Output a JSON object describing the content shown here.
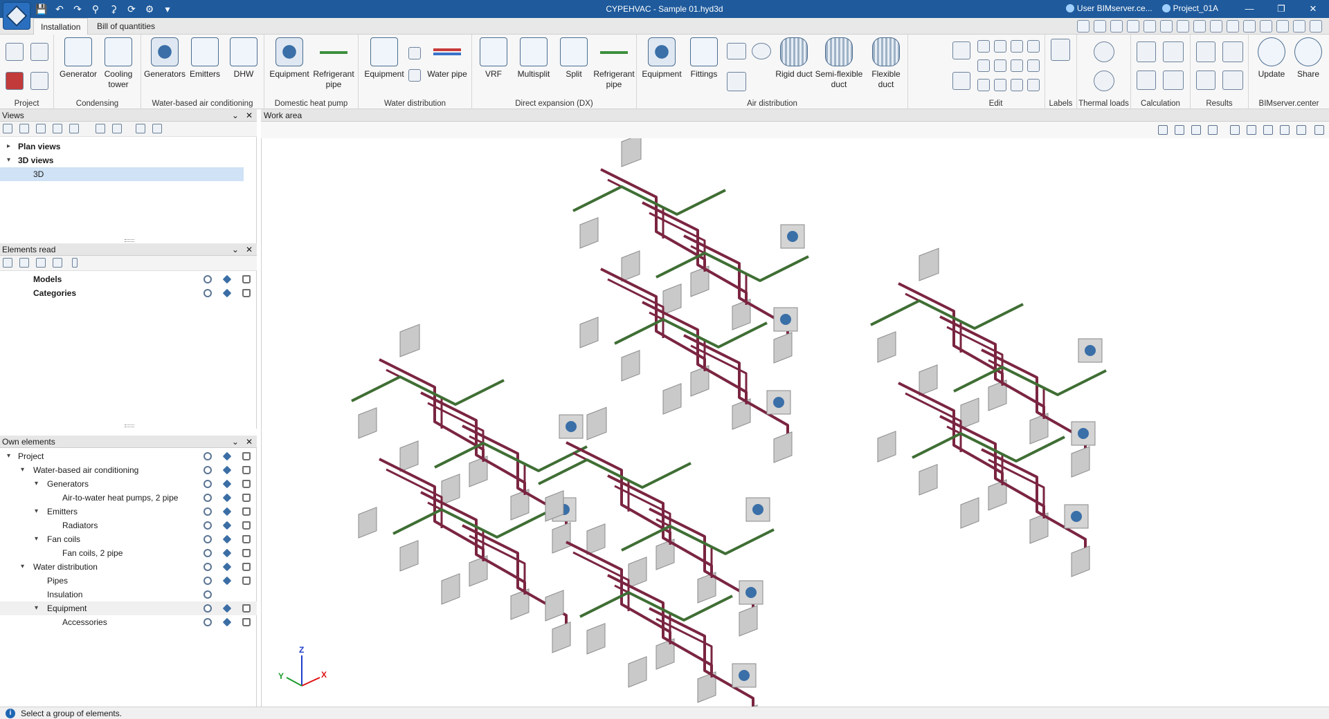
{
  "titlebar": {
    "title": "CYPEHVAC - Sample 01.hyd3d",
    "user": "User BIMserver.ce...",
    "project": "Project_01A",
    "qat_icons": [
      "save-icon",
      "undo-icon",
      "redo-icon",
      "search-icon",
      "zoom-icon",
      "refresh-icon",
      "settings-icon",
      "dropdown-icon"
    ]
  },
  "tabs": [
    {
      "label": "Installation",
      "active": true
    },
    {
      "label": "Bill of quantities",
      "active": false
    }
  ],
  "ribbon": {
    "groups": [
      {
        "label": "Project"
      },
      {
        "label": "Condensing",
        "buttons": [
          "Generator",
          "Cooling tower"
        ]
      },
      {
        "label": "Water-based air conditioning",
        "buttons": [
          "Generators",
          "Emitters",
          "DHW"
        ]
      },
      {
        "label": "Domestic heat pump",
        "buttons": [
          "Equipment",
          "Refrigerant pipe"
        ]
      },
      {
        "label": "Water distribution",
        "buttons": [
          "Equipment",
          "Water pipe"
        ]
      },
      {
        "label": "Direct expansion (DX)",
        "buttons": [
          "VRF",
          "Multisplit",
          "Split",
          "Refrigerant pipe"
        ]
      },
      {
        "label": "Air distribution",
        "buttons": [
          "Equipment",
          "Fittings",
          "Rigid duct",
          "Semi-flexible duct",
          "Flexible duct"
        ]
      },
      {
        "label": "Edit"
      },
      {
        "label": "Labels"
      },
      {
        "label": "Thermal loads"
      },
      {
        "label": "Calculation"
      },
      {
        "label": "Results"
      },
      {
        "label": "BIMserver.center",
        "buttons": [
          "Update",
          "Share"
        ]
      }
    ]
  },
  "views_panel": {
    "title": "Views",
    "items": [
      {
        "label": "Plan views",
        "expanded": false
      },
      {
        "label": "3D views",
        "expanded": true
      },
      {
        "label": "3D",
        "selected": true
      }
    ]
  },
  "elements_read_panel": {
    "title": "Elements read",
    "items": [
      {
        "label": "Models"
      },
      {
        "label": "Categories"
      }
    ]
  },
  "own_elements_panel": {
    "title": "Own elements",
    "items": [
      {
        "label": "Project"
      },
      {
        "label": "Water-based air conditioning"
      },
      {
        "label": "Generators"
      },
      {
        "label": "Air-to-water heat pumps, 2 pipe"
      },
      {
        "label": "Emitters"
      },
      {
        "label": "Radiators"
      },
      {
        "label": "Fan coils"
      },
      {
        "label": "Fan coils, 2 pipe"
      },
      {
        "label": "Water distribution"
      },
      {
        "label": "Pipes"
      },
      {
        "label": "Insulation"
      },
      {
        "label": "Equipment"
      },
      {
        "label": "Accessories"
      }
    ]
  },
  "work_area": {
    "title": "Work area",
    "axes": {
      "x": "X",
      "y": "Y",
      "z": "Z"
    }
  },
  "status": {
    "text": "Select a group of elements."
  },
  "colors": {
    "titlebar": "#1e5a9c",
    "pipe_supply": "#7a2540",
    "pipe_return": "#3f6e34",
    "selection": "#cfe2f6"
  }
}
